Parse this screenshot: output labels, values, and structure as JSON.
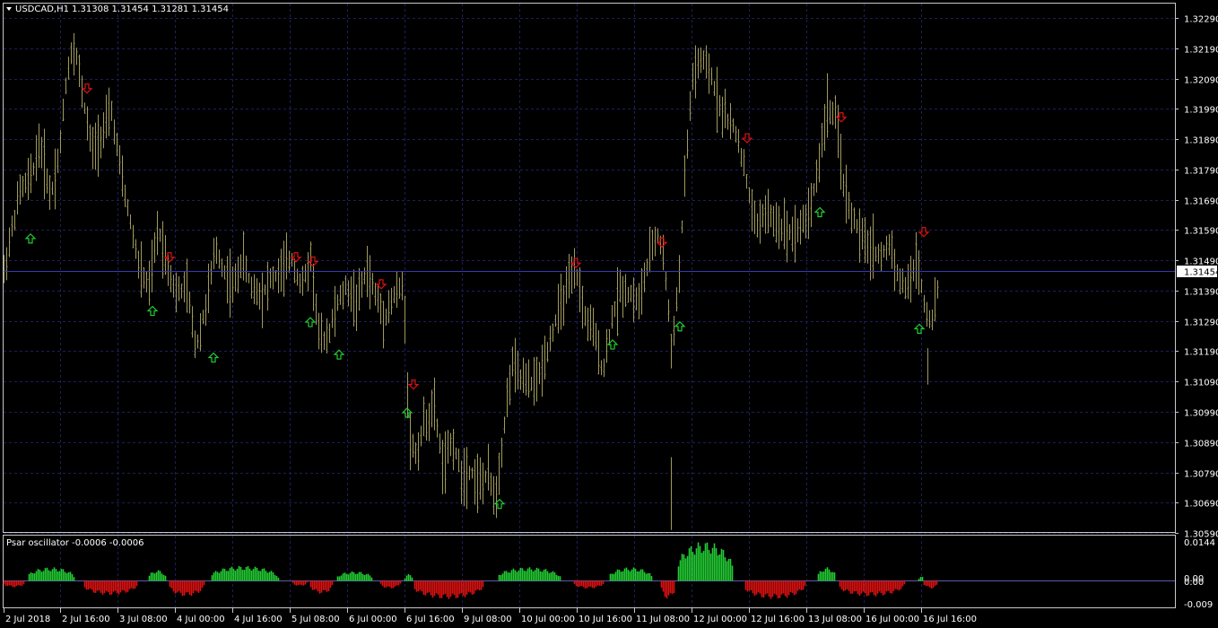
{
  "window": {
    "symbol_label": "USDCAD,H1",
    "ohlc": "1.31308 1.31454 1.31281 1.31454",
    "current_price": "1.31454"
  },
  "oscillator": {
    "label": "Psar oscillator -0.0006 -0.0006",
    "axis_labels": [
      "0.0144",
      "0.00",
      "0.00",
      "-0.009"
    ]
  },
  "colors": {
    "background": "#000000",
    "grid": "#1c1f5a",
    "bars": "#a09a5a",
    "up_arrow": "#22cc33",
    "down_arrow": "#dd1111",
    "osc_positive": "#22cc33",
    "osc_negative": "#dd1111"
  },
  "chart_data": [
    {
      "type": "ohlc",
      "title": "USDCAD,H1",
      "y_tick_labels": [
        "1.32290",
        "1.32190",
        "1.32090",
        "1.31990",
        "1.31890",
        "1.31790",
        "1.31690",
        "1.31590",
        "1.31490",
        "1.31390",
        "1.31290",
        "1.31190",
        "1.31090",
        "1.30990",
        "1.30890",
        "1.30790",
        "1.30690",
        "1.30590"
      ],
      "ylim": [
        1.3055,
        1.3232
      ],
      "x_tick_labels": [
        "2 Jul 2018",
        "2 Jul 16:00",
        "3 Jul 08:00",
        "4 Jul 00:00",
        "4 Jul 16:00",
        "5 Jul 08:00",
        "6 Jul 00:00",
        "6 Jul 16:00",
        "9 Jul 08:00",
        "10 Jul 00:00",
        "10 Jul 16:00",
        "11 Jul 08:00",
        "12 Jul 00:00",
        "12 Jul 16:00",
        "13 Jul 08:00",
        "16 Jul 00:00",
        "16 Jul 16:00"
      ],
      "price_path": [
        [
          0,
          1.3145
        ],
        [
          8,
          1.3158
        ],
        [
          18,
          1.3172
        ],
        [
          30,
          1.3176
        ],
        [
          40,
          1.3188
        ],
        [
          52,
          1.317
        ],
        [
          62,
          1.3185
        ],
        [
          70,
          1.321
        ],
        [
          78,
          1.3222
        ],
        [
          88,
          1.3203
        ],
        [
          98,
          1.3185
        ],
        [
          108,
          1.319
        ],
        [
          120,
          1.3198
        ],
        [
          132,
          1.3175
        ],
        [
          142,
          1.316
        ],
        [
          152,
          1.3145
        ],
        [
          162,
          1.314
        ],
        [
          172,
          1.316
        ],
        [
          182,
          1.3148
        ],
        [
          192,
          1.3138
        ],
        [
          204,
          1.314
        ],
        [
          214,
          1.312
        ],
        [
          226,
          1.3135
        ],
        [
          236,
          1.3153
        ],
        [
          246,
          1.3145
        ],
        [
          256,
          1.314
        ],
        [
          266,
          1.315
        ],
        [
          276,
          1.314
        ],
        [
          288,
          1.3138
        ],
        [
          298,
          1.3143
        ],
        [
          310,
          1.3145
        ],
        [
          320,
          1.315
        ],
        [
          332,
          1.314
        ],
        [
          342,
          1.315
        ],
        [
          352,
          1.3122
        ],
        [
          362,
          1.3125
        ],
        [
          372,
          1.3135
        ],
        [
          382,
          1.314
        ],
        [
          394,
          1.3135
        ],
        [
          404,
          1.3146
        ],
        [
          414,
          1.3138
        ],
        [
          424,
          1.313
        ],
        [
          436,
          1.3138
        ],
        [
          446,
          1.314
        ],
        [
          452,
          1.309
        ],
        [
          460,
          1.3085
        ],
        [
          468,
          1.3095
        ],
        [
          480,
          1.31
        ],
        [
          490,
          1.308
        ],
        [
          500,
          1.309
        ],
        [
          510,
          1.3078
        ],
        [
          520,
          1.308
        ],
        [
          530,
          1.3075
        ],
        [
          540,
          1.3078
        ],
        [
          548,
          1.307
        ],
        [
          556,
          1.309
        ],
        [
          566,
          1.3115
        ],
        [
          576,
          1.311
        ],
        [
          586,
          1.3108
        ],
        [
          596,
          1.311
        ],
        [
          606,
          1.312
        ],
        [
          616,
          1.313
        ],
        [
          628,
          1.314
        ],
        [
          638,
          1.3145
        ],
        [
          648,
          1.313
        ],
        [
          658,
          1.3125
        ],
        [
          668,
          1.3112
        ],
        [
          678,
          1.313
        ],
        [
          688,
          1.314
        ],
        [
          698,
          1.3138
        ],
        [
          708,
          1.3135
        ],
        [
          718,
          1.3148
        ],
        [
          728,
          1.3158
        ],
        [
          736,
          1.315
        ],
        [
          744,
          1.312
        ],
        [
          752,
          1.314
        ],
        [
          760,
          1.318
        ],
        [
          768,
          1.321
        ],
        [
          778,
          1.3215
        ],
        [
          788,
          1.321
        ],
        [
          798,
          1.32
        ],
        [
          808,
          1.3195
        ],
        [
          818,
          1.319
        ],
        [
          828,
          1.3175
        ],
        [
          838,
          1.316
        ],
        [
          848,
          1.3165
        ],
        [
          858,
          1.3162
        ],
        [
          868,
          1.316
        ],
        [
          878,
          1.3158
        ],
        [
          888,
          1.316
        ],
        [
          898,
          1.3165
        ],
        [
          908,
          1.318
        ],
        [
          918,
          1.32
        ],
        [
          928,
          1.3195
        ],
        [
          938,
          1.317
        ],
        [
          948,
          1.3162
        ],
        [
          958,
          1.3155
        ],
        [
          968,
          1.3153
        ],
        [
          978,
          1.315
        ],
        [
          988,
          1.3155
        ],
        [
          998,
          1.3142
        ],
        [
          1008,
          1.314
        ],
        [
          1018,
          1.315
        ],
        [
          1026,
          1.3135
        ],
        [
          1034,
          1.3128
        ],
        [
          1042,
          1.314
        ],
        [
          1045,
          1.3145
        ]
      ],
      "psar_arrows": [
        {
          "t": 30,
          "price": 1.31562,
          "dir": "up"
        },
        {
          "t": 93,
          "price": 1.32057,
          "dir": "down"
        },
        {
          "t": 166,
          "price": 1.31323,
          "dir": "up"
        },
        {
          "t": 185,
          "price": 1.315,
          "dir": "down"
        },
        {
          "t": 234,
          "price": 1.31169,
          "dir": "up"
        },
        {
          "t": 326,
          "price": 1.315,
          "dir": "down"
        },
        {
          "t": 342,
          "price": 1.31286,
          "dir": "up"
        },
        {
          "t": 345,
          "price": 1.31486,
          "dir": "down"
        },
        {
          "t": 374,
          "price": 1.31179,
          "dir": "up"
        },
        {
          "t": 421,
          "price": 1.31411,
          "dir": "down"
        },
        {
          "t": 450,
          "price": 1.30987,
          "dir": "up"
        },
        {
          "t": 457,
          "price": 1.3108,
          "dir": "down"
        },
        {
          "t": 553,
          "price": 1.30686,
          "dir": "up"
        },
        {
          "t": 638,
          "price": 1.31481,
          "dir": "down"
        },
        {
          "t": 679,
          "price": 1.31212,
          "dir": "up"
        },
        {
          "t": 734,
          "price": 1.31549,
          "dir": "down"
        },
        {
          "t": 754,
          "price": 1.31272,
          "dir": "up"
        },
        {
          "t": 829,
          "price": 1.31893,
          "dir": "down"
        },
        {
          "t": 910,
          "price": 1.31649,
          "dir": "up"
        },
        {
          "t": 934,
          "price": 1.31962,
          "dir": "down"
        },
        {
          "t": 1021,
          "price": 1.31264,
          "dir": "up"
        },
        {
          "t": 1026,
          "price": 1.31583,
          "dir": "down"
        }
      ]
    },
    {
      "type": "bar",
      "title": "Psar oscillator -0.0006 -0.0006",
      "ylim": [
        -0.009,
        0.0144
      ],
      "y_tick_labels": [
        "0.0144",
        "0.00",
        "0.00",
        "-0.009"
      ],
      "segments": [
        {
          "from": 0,
          "to": 28,
          "value": -0.0025
        },
        {
          "from": 28,
          "to": 90,
          "value": 0.005
        },
        {
          "from": 90,
          "to": 162,
          "value": -0.0055
        },
        {
          "from": 162,
          "to": 185,
          "value": 0.004
        },
        {
          "from": 185,
          "to": 232,
          "value": -0.006
        },
        {
          "from": 232,
          "to": 322,
          "value": 0.0055
        },
        {
          "from": 322,
          "to": 342,
          "value": -0.002
        },
        {
          "from": 342,
          "to": 372,
          "value": -0.005
        },
        {
          "from": 372,
          "to": 420,
          "value": 0.0035
        },
        {
          "from": 420,
          "to": 447,
          "value": -0.003
        },
        {
          "from": 447,
          "to": 458,
          "value": 0.0025
        },
        {
          "from": 458,
          "to": 552,
          "value": -0.007
        },
        {
          "from": 552,
          "to": 636,
          "value": 0.005
        },
        {
          "from": 636,
          "to": 676,
          "value": -0.003
        },
        {
          "from": 676,
          "to": 733,
          "value": 0.005
        },
        {
          "from": 733,
          "to": 752,
          "value": -0.007
        },
        {
          "from": 752,
          "to": 827,
          "value": 0.0144
        },
        {
          "from": 827,
          "to": 908,
          "value": -0.007
        },
        {
          "from": 908,
          "to": 932,
          "value": 0.005
        },
        {
          "from": 932,
          "to": 1020,
          "value": -0.006
        },
        {
          "from": 1020,
          "to": 1026,
          "value": 0.002
        },
        {
          "from": 1026,
          "to": 1045,
          "value": -0.003
        }
      ]
    }
  ]
}
